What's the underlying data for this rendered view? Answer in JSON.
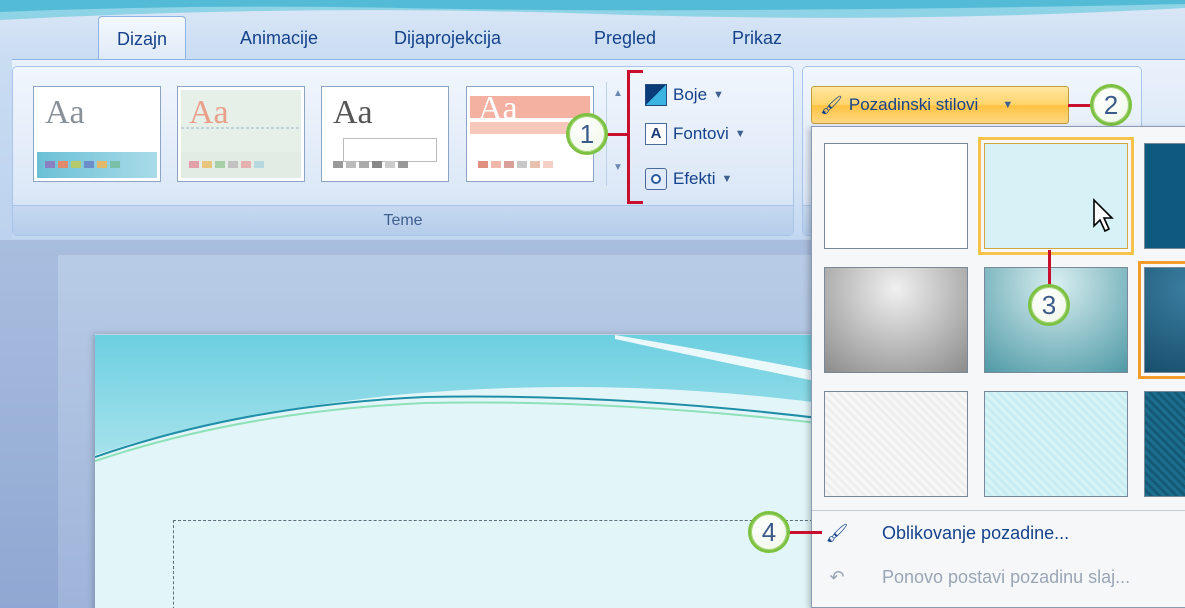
{
  "tabs": [
    {
      "label": "Dizajn",
      "active": true
    },
    {
      "label": "Animacije",
      "active": false
    },
    {
      "label": "Dijaprojekcija",
      "active": false
    },
    {
      "label": "Pregled",
      "active": false
    },
    {
      "label": "Prikaz",
      "active": false
    }
  ],
  "themes_group": {
    "label": "Teme",
    "thumbnails": [
      {
        "sample": "Aa",
        "name": "theme-office"
      },
      {
        "sample": "Aa",
        "name": "theme-coral"
      },
      {
        "sample": "Aa",
        "name": "theme-plain"
      },
      {
        "sample": "Aa",
        "name": "theme-salmon"
      }
    ],
    "buttons": {
      "colors": "Boje",
      "fonts": "Fontovi",
      "effects": "Efekti"
    },
    "font_icon_glyph": "A"
  },
  "background": {
    "button_label": "Pozadinski stilovi",
    "menu": {
      "format_background": "Oblikovanje pozadine...",
      "reset_background": "Ponovo postavi pozadinu slaj..."
    }
  },
  "callouts": [
    "1",
    "2",
    "3",
    "4"
  ],
  "icons": {
    "colors": "color-palette-icon",
    "fonts": "font-a-icon",
    "effects": "effects-circle-icon",
    "background": "paint-bucket-icon",
    "reset": "reset-background-icon",
    "cursor": "mouse-pointer-icon",
    "dropdown": "chevron-down-icon"
  },
  "colors": {
    "accent_gold": "#ffc240",
    "callout_green": "#7cc142",
    "callout_line": "#c8102e",
    "ribbon_text": "#15428b"
  }
}
